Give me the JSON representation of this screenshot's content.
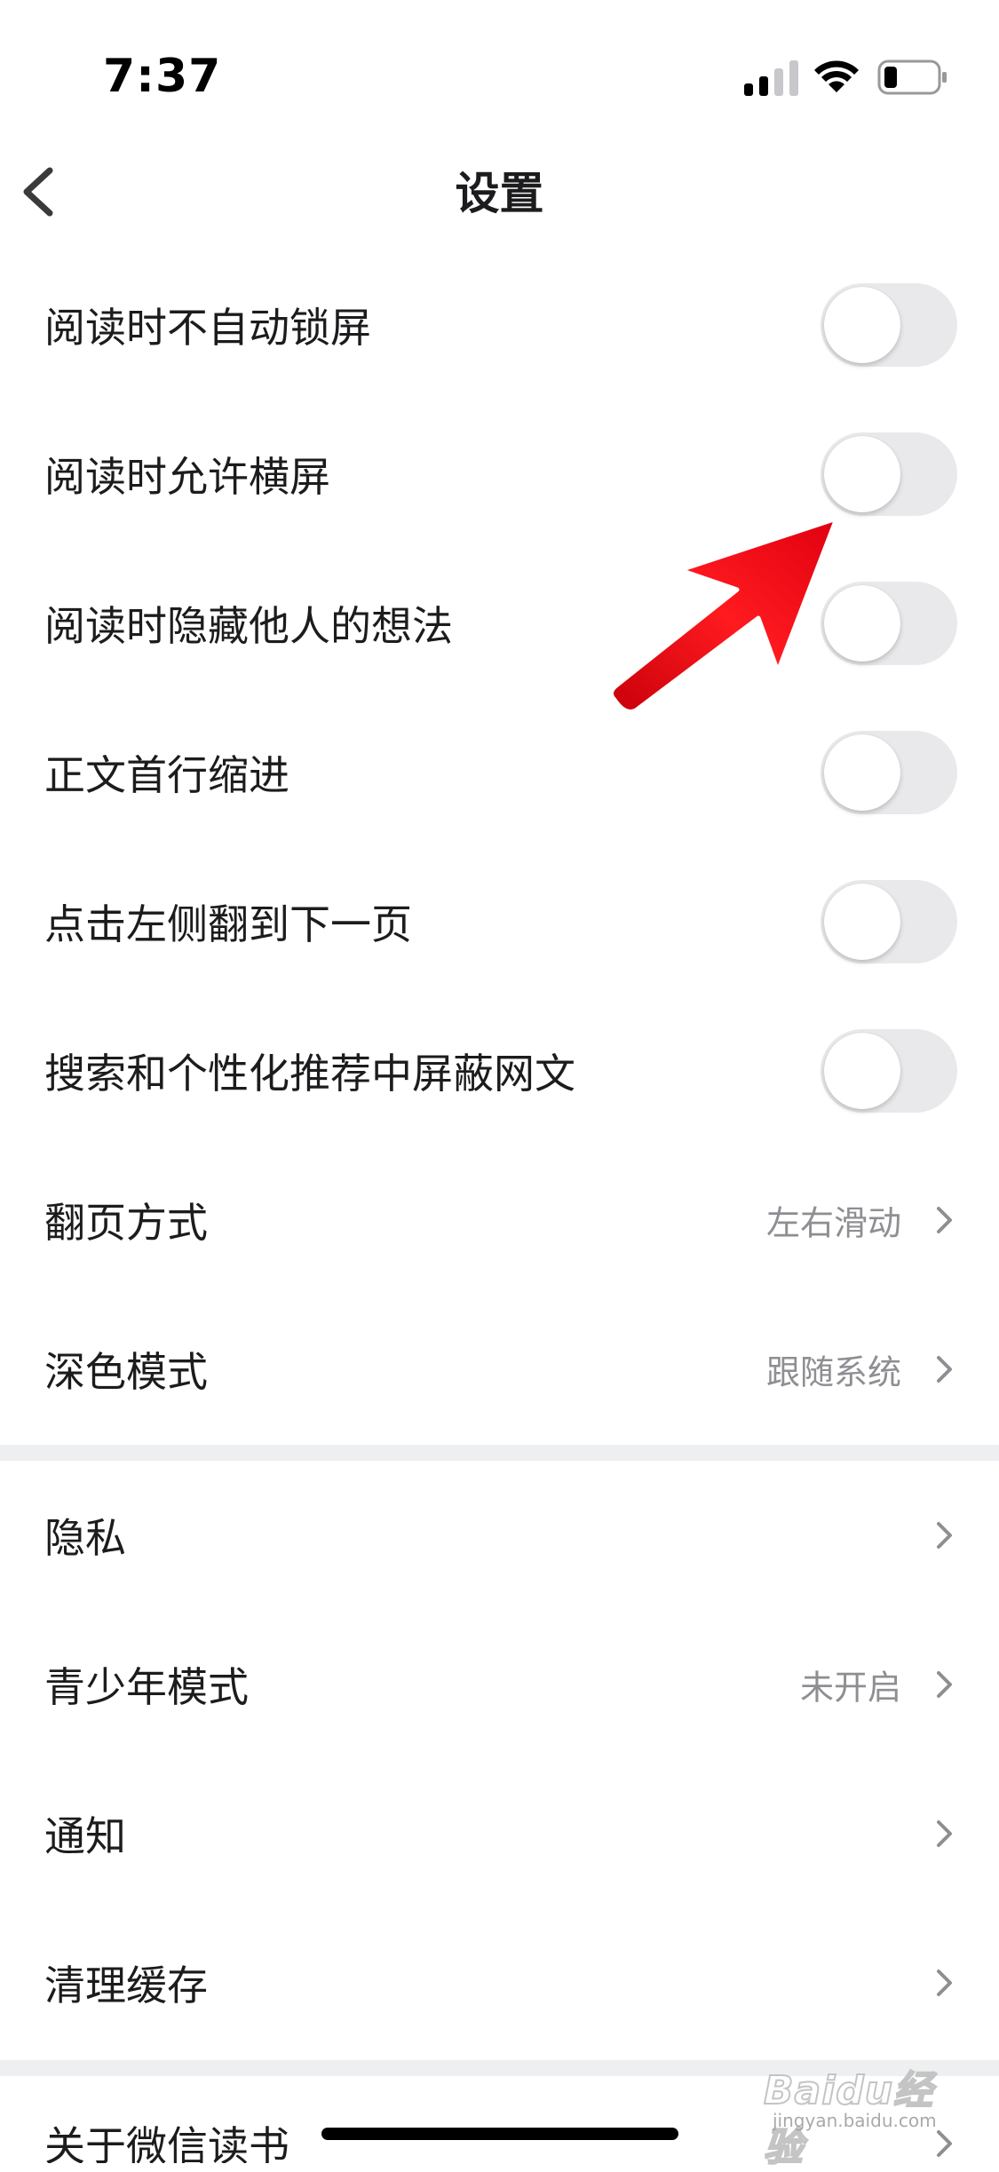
{
  "status_bar": {
    "time": "7:37",
    "icons": [
      "cellular-signal-icon",
      "wifi-icon",
      "battery-icon"
    ]
  },
  "header": {
    "back_icon": "chevron-left-icon",
    "title": "设置"
  },
  "toggle_rows": [
    {
      "label": "阅读时不自动锁屏",
      "enabled": false
    },
    {
      "label": "阅读时允许横屏",
      "enabled": false
    },
    {
      "label": "阅读时隐藏他人的想法",
      "enabled": false
    },
    {
      "label": "正文首行缩进",
      "enabled": false
    },
    {
      "label": "点击左侧翻到下一页",
      "enabled": false
    },
    {
      "label": "搜索和个性化推荐中屏蔽网文",
      "enabled": false
    }
  ],
  "value_rows": [
    {
      "label": "翻页方式",
      "value": "左右滑动"
    },
    {
      "label": "深色模式",
      "value": "跟随系统"
    }
  ],
  "section2_rows": [
    {
      "label": "隐私",
      "value": ""
    },
    {
      "label": "青少年模式",
      "value": "未开启"
    },
    {
      "label": "通知",
      "value": ""
    },
    {
      "label": "清理缓存",
      "value": ""
    }
  ],
  "section3_rows": [
    {
      "label": "关于微信读书",
      "value": ""
    }
  ],
  "annotation": {
    "arrow_color": "#e8141b",
    "points_to": "阅读时允许横屏"
  },
  "watermark": {
    "brand": "Baidu经验",
    "url": "jingyan.baidu.com"
  },
  "colors": {
    "toggle_off": "#e9e9eb",
    "secondary_text": "#8e8e93",
    "divider": "#eeeff1"
  }
}
